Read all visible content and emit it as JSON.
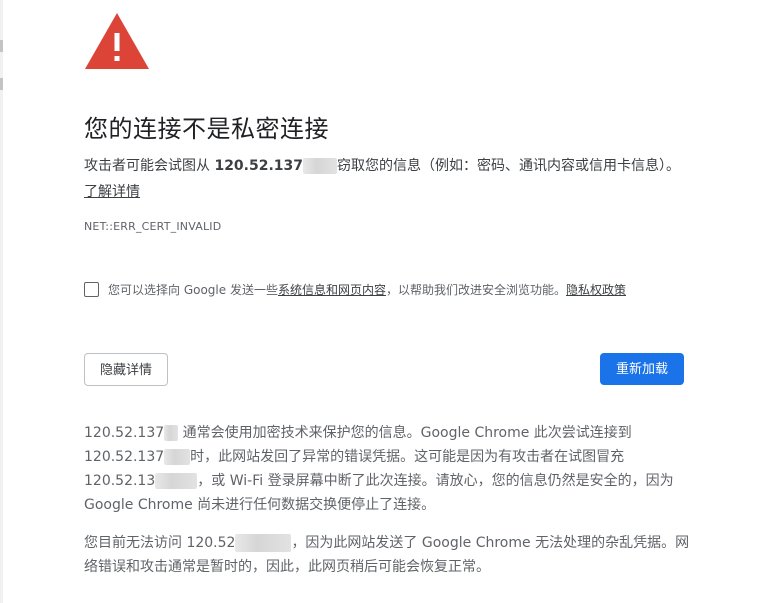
{
  "icon": "warning-triangle-icon",
  "colors": {
    "warning": "#db4437",
    "accent": "#1a73e8",
    "text": "#3c4043",
    "secondary_text": "#5f6368"
  },
  "title": "您的连接不是私密连接",
  "description": {
    "part1": "攻击者可能会试图从 ",
    "host": "120.52.137",
    "part2": "窃取您的信息（例如：密码、通讯内容或信用卡信息）。",
    "learn_more": "了解详情"
  },
  "error_code": "NET::ERR_CERT_INVALID",
  "report": {
    "prefix": "您可以选择向 Google 发送一些",
    "link": "系统信息和网页内容",
    "suffix": "，以帮助我们改进安全浏览功能。",
    "privacy_link": "隐私权政策",
    "checked": false
  },
  "buttons": {
    "hide_details": "隐藏详情",
    "reload": "重新加载"
  },
  "details": {
    "p1_a": "120.52.137",
    "p1_b": " 通常会使用加密技术来保护您的信息。Google Chrome 此次尝试连接到 ",
    "p1_c": "120.52.137",
    "p1_d": "时，此网站发回了异常的错误凭据。这可能是因为有攻击者在试图冒充 ",
    "p1_e": "120.52.13",
    "p1_f": "，或 Wi-Fi 登录屏幕中断了此次连接。请放心，您的信息仍然是安全的，因为 Google Chrome 尚未进行任何数据交换便停止了连接。",
    "p2_a": "您目前无法访问 120.52",
    "p2_b": "，因为此网站发送了 Google Chrome 无法处理的杂乱凭据。网络错误和攻击通常是暂时的，因此，此网页稍后可能会恢复正常。"
  }
}
